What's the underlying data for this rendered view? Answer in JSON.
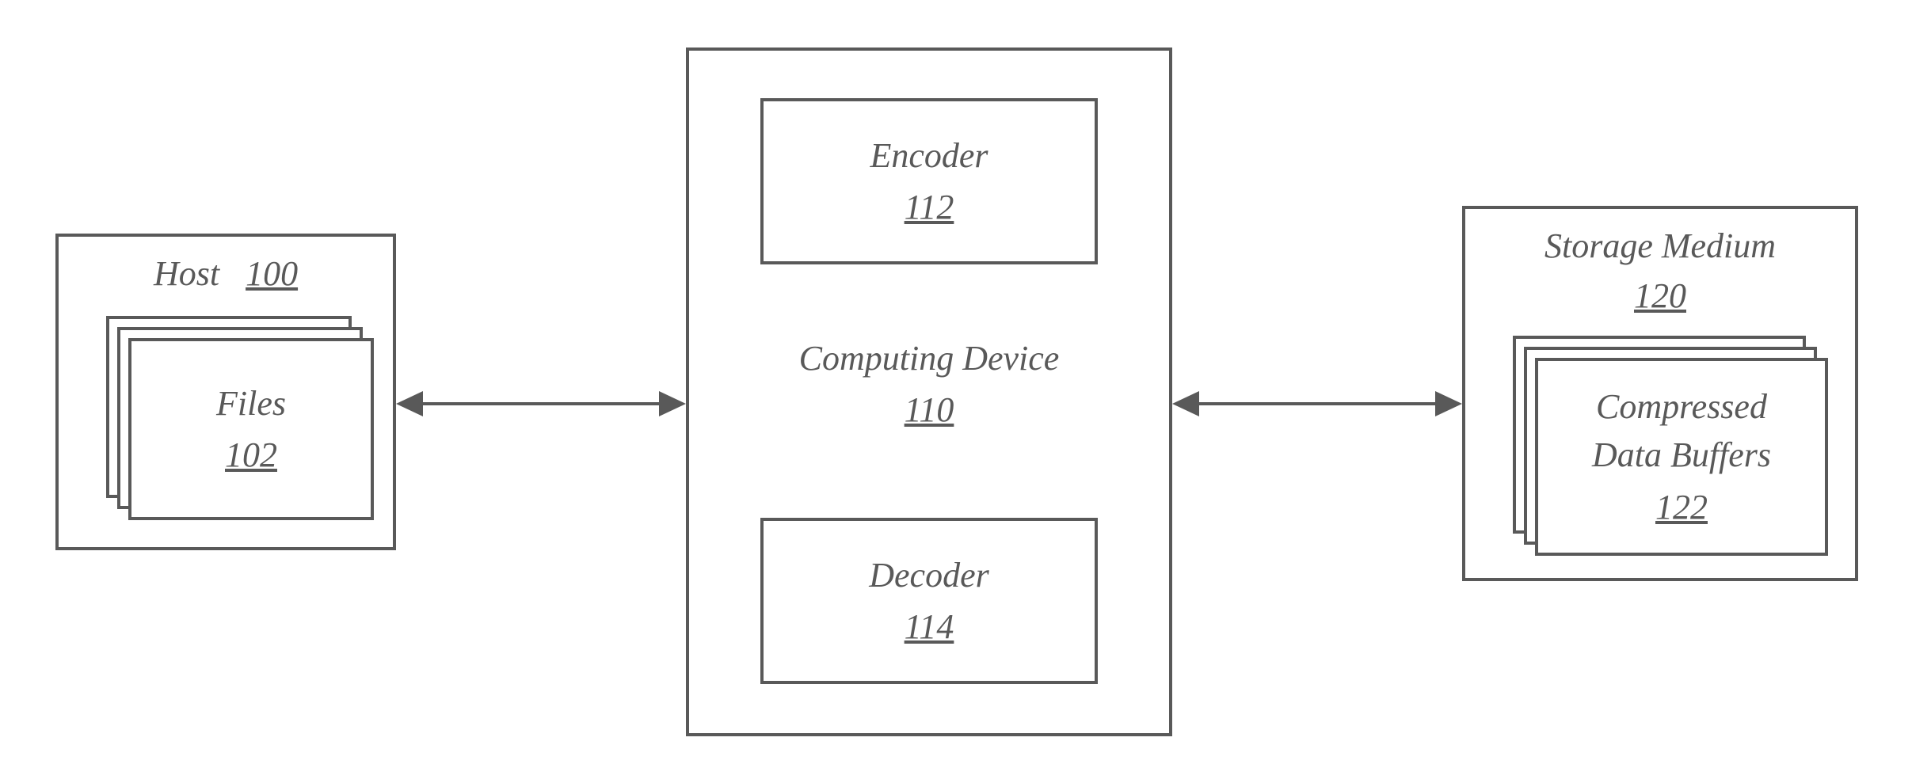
{
  "host": {
    "title": "Host",
    "ref": "100",
    "files_label": "Files",
    "files_ref": "102"
  },
  "device": {
    "title": "Computing Device",
    "ref": "110",
    "encoder_label": "Encoder",
    "encoder_ref": "112",
    "decoder_label": "Decoder",
    "decoder_ref": "114"
  },
  "storage": {
    "title": "Storage Medium",
    "ref": "120",
    "buffers_label_1": "Compressed",
    "buffers_label_2": "Data Buffers",
    "buffers_ref": "122"
  }
}
